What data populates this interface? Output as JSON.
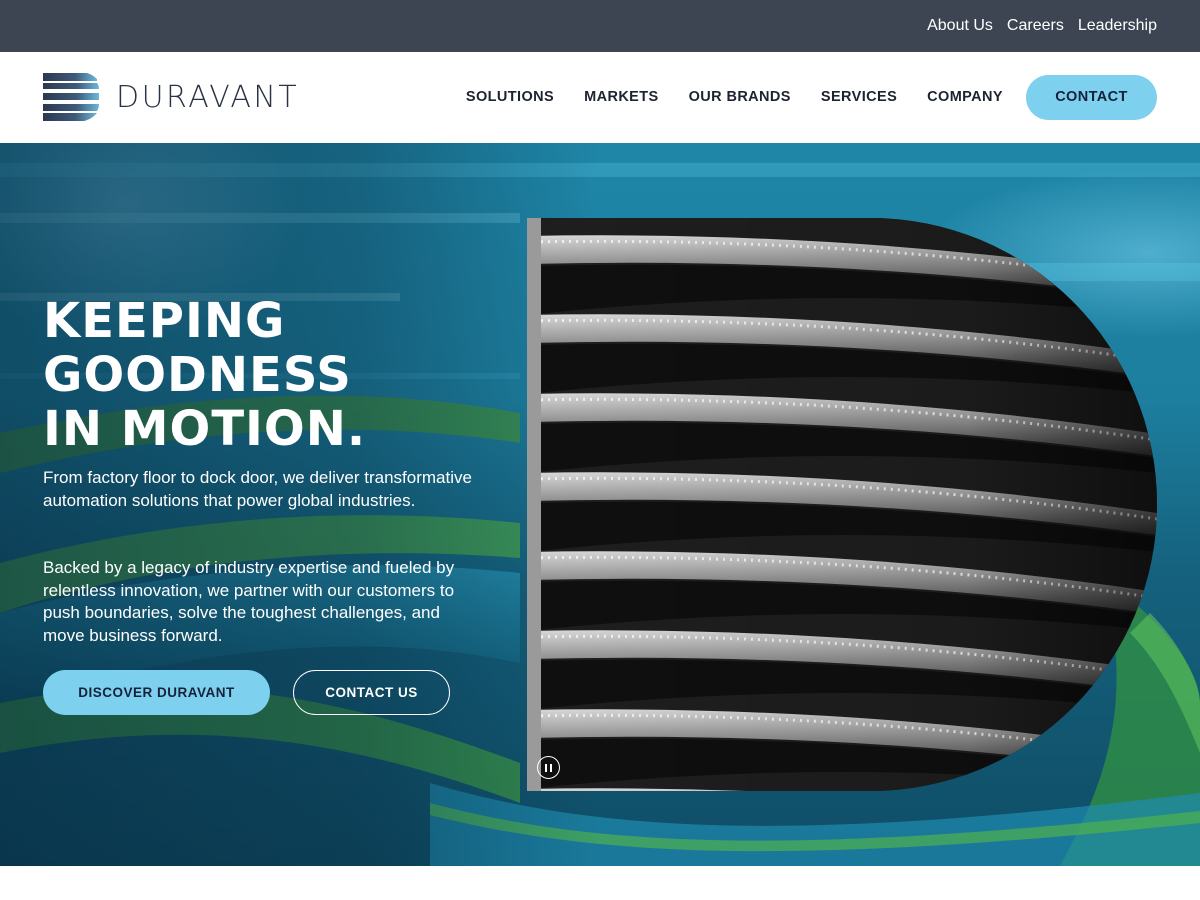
{
  "utility_nav": [
    "About Us",
    "Careers",
    "Leadership"
  ],
  "brand": {
    "name": "DURAVANT",
    "logo_icon": "duravant-d-logo-icon"
  },
  "main_nav": {
    "items": [
      "SOLUTIONS",
      "MARKETS",
      "OUR BRANDS",
      "SERVICES",
      "COMPANY"
    ],
    "contact_label": "CONTACT"
  },
  "hero": {
    "title_lines": [
      "KEEPING",
      "GOODNESS",
      "IN MOTION."
    ],
    "paragraph_1": "From factory floor to dock door, we deliver transformative automation solutions that power global industries.",
    "paragraph_2": "Backed by a legacy of industry expertise and fueled by relentless innovation, we partner with our customers to push boundaries, solve the toughest challenges, and move business forward.",
    "primary_cta": "DISCOVER DURAVANT",
    "secondary_cta": "CONTACT US",
    "video_control_icon": "pause-icon"
  },
  "colors": {
    "utility_bar": "#3d4553",
    "accent": "#7dd0ee",
    "heading_text": "#1d2330",
    "hero_teal": "#1d7f9f"
  }
}
